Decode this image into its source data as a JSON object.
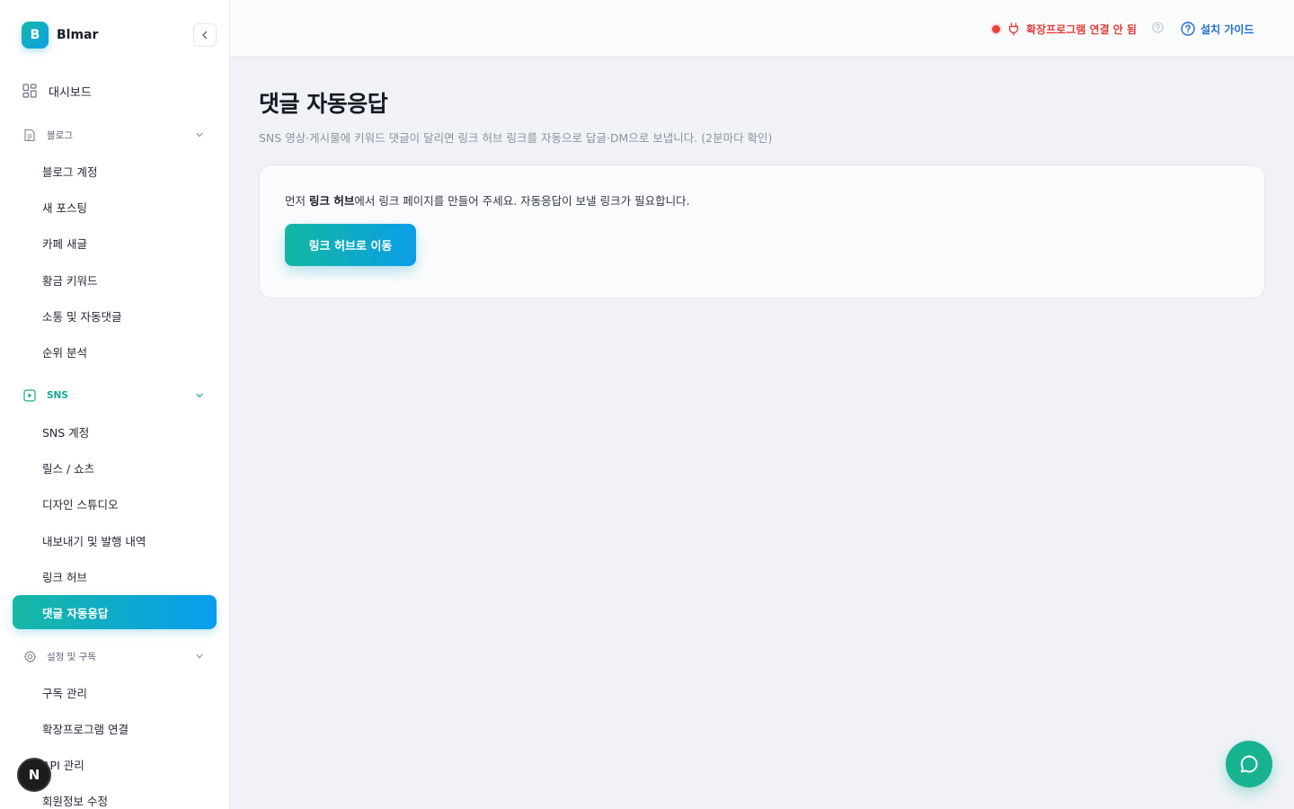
{
  "brand": {
    "logo_letter": "B",
    "name": "Blmar"
  },
  "sidebar": {
    "dashboard_label": "대시보드",
    "groups": [
      {
        "label": "블로그",
        "icon": "document-icon",
        "items": [
          "블로그 계정",
          "새 포스팅",
          "카페 새글",
          "황금 키워드",
          "소통 및 자동댓글",
          "순위 분석"
        ]
      },
      {
        "label": "SNS",
        "icon": "play-square-icon",
        "items": [
          "SNS 계정",
          "릴스 / 쇼츠",
          "디자인 스튜디오",
          "내보내기 및 발행 내역",
          "링크 허브",
          "댓글 자동응답"
        ]
      },
      {
        "label": "설정 및 구독",
        "icon": "gear-icon",
        "items": [
          "구독 관리",
          "확장프로그램 연결",
          "API 관리",
          "회원정보 수정"
        ]
      }
    ],
    "active_item": "댓글 자동응답",
    "badge_letter": "N"
  },
  "topbar": {
    "extension_status": "확장프로그램 연결 안 됨",
    "guide_label": "설치 가이드"
  },
  "main": {
    "title": "댓글 자동응답",
    "subtitle": "SNS 영상·게시물에 키워드 댓글이 달리면 링크 허브 링크를 자동으로 답글·DM으로 보냅니다. (2분마다 확인)",
    "notice": {
      "prefix": "먼저 ",
      "bold": "링크 허브",
      "suffix": "에서 링크 페이지를 만들어 주세요. 자동응답이 보낼 링크가 필요합니다."
    },
    "cta_label": "링크 허브로 이동"
  },
  "colors": {
    "accent": "#16b8a3",
    "accent_blue": "#0a9cf0",
    "error": "#e0403d",
    "link": "#1f6fd6"
  }
}
